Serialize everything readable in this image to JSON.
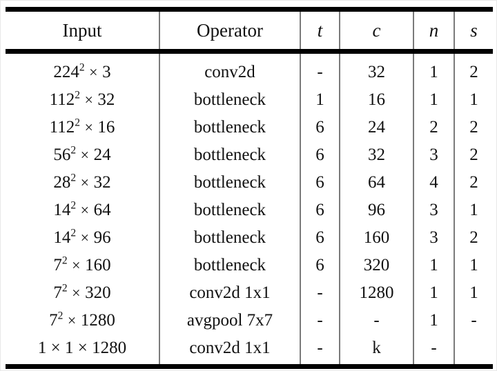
{
  "table": {
    "caption": "",
    "columns": [
      {
        "key": "input",
        "label": "Input",
        "style": "roman"
      },
      {
        "key": "operator",
        "label": "Operator",
        "style": "roman"
      },
      {
        "key": "t",
        "label": "t",
        "style": "italic"
      },
      {
        "key": "c",
        "label": "c",
        "style": "italic"
      },
      {
        "key": "n",
        "label": "n",
        "style": "italic"
      },
      {
        "key": "s",
        "label": "s",
        "style": "italic"
      }
    ],
    "rows": [
      {
        "input": "224² × 3",
        "input_base": "224",
        "input_exp": "2",
        "input_tail": "3",
        "operator": "conv2d",
        "t": "-",
        "c": "32",
        "n": "1",
        "s": "2"
      },
      {
        "input": "112² × 32",
        "input_base": "112",
        "input_exp": "2",
        "input_tail": "32",
        "operator": "bottleneck",
        "t": "1",
        "c": "16",
        "n": "1",
        "s": "1"
      },
      {
        "input": "112² × 16",
        "input_base": "112",
        "input_exp": "2",
        "input_tail": "16",
        "operator": "bottleneck",
        "t": "6",
        "c": "24",
        "n": "2",
        "s": "2"
      },
      {
        "input": "56² × 24",
        "input_base": "56",
        "input_exp": "2",
        "input_tail": "24",
        "operator": "bottleneck",
        "t": "6",
        "c": "32",
        "n": "3",
        "s": "2"
      },
      {
        "input": "28² × 32",
        "input_base": "28",
        "input_exp": "2",
        "input_tail": "32",
        "operator": "bottleneck",
        "t": "6",
        "c": "64",
        "n": "4",
        "s": "2"
      },
      {
        "input": "14² × 64",
        "input_base": "14",
        "input_exp": "2",
        "input_tail": "64",
        "operator": "bottleneck",
        "t": "6",
        "c": "96",
        "n": "3",
        "s": "1"
      },
      {
        "input": "14² × 96",
        "input_base": "14",
        "input_exp": "2",
        "input_tail": "96",
        "operator": "bottleneck",
        "t": "6",
        "c": "160",
        "n": "3",
        "s": "2"
      },
      {
        "input": "7² × 160",
        "input_base": "7",
        "input_exp": "2",
        "input_tail": "160",
        "operator": "bottleneck",
        "t": "6",
        "c": "320",
        "n": "1",
        "s": "1"
      },
      {
        "input": "7² × 320",
        "input_base": "7",
        "input_exp": "2",
        "input_tail": "320",
        "operator": "conv2d 1x1",
        "t": "-",
        "c": "1280",
        "n": "1",
        "s": "1"
      },
      {
        "input": "7² × 1280",
        "input_base": "7",
        "input_exp": "2",
        "input_tail": "1280",
        "operator": "avgpool 7x7",
        "t": "-",
        "c": "-",
        "n": "1",
        "s": "-"
      },
      {
        "input": "1 × 1 × 1280",
        "input_base": "1",
        "input_exp": "",
        "input_tail": "1 × 1280",
        "operator": "conv2d 1x1",
        "t": "-",
        "c": "k",
        "n": "-",
        "s": ""
      }
    ]
  },
  "style": {
    "rule_color": "#000000",
    "separator_color": "#7a7a7a",
    "text_color": "#111111",
    "background": "#ffffff"
  }
}
